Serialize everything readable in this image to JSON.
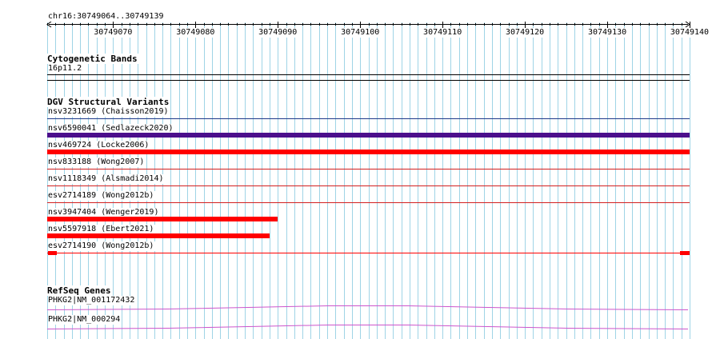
{
  "ruler": {
    "range_label": "chr16:30749064..30749139",
    "start": 30749062,
    "end": 30749140,
    "tick_labels": [
      "30749070",
      "30749080",
      "30749090",
      "30749100",
      "30749110",
      "30749120",
      "30749130",
      "30749140"
    ]
  },
  "tracks": {
    "cytoband": {
      "title": "Cytogenetic Bands",
      "band": "16p11.2"
    },
    "dgv": {
      "title": "DGV Structural Variants",
      "variants": [
        {
          "label": "nsv3231669 (Chaisson2019)",
          "start": 30749062,
          "end": 30749140,
          "color": "#1f3a8a",
          "thick": false
        },
        {
          "label": "nsv6590041 (Sedlazeck2020)",
          "start": 30749062,
          "end": 30749140,
          "color": "#4b0f8c",
          "thick": true
        },
        {
          "label": "nsv469724 (Locke2006)",
          "start": 30749062,
          "end": 30749140,
          "color": "#ff0000",
          "thick": true
        },
        {
          "label": "nsv833188 (Wong2007)",
          "start": 30749062,
          "end": 30749140,
          "color": "#d22020",
          "thick": false
        },
        {
          "label": "nsv1118349 (Alsmadi2014)",
          "start": 30749062,
          "end": 30749140,
          "color": "#d22020",
          "thick": false
        },
        {
          "label": "esv2714189 (Wong2012b)",
          "start": 30749062,
          "end": 30749140,
          "color": "#d22020",
          "thick": false
        },
        {
          "label": "nsv3947404 (Wenger2019)",
          "start": 30749062,
          "end": 30749090,
          "color": "#ff0000",
          "thick": true
        },
        {
          "label": "nsv5597918 (Ebert2021)",
          "start": 30749062,
          "end": 30749089,
          "color": "#ff0000",
          "thick": true
        },
        {
          "label": "esv2714190 (Wong2012b)",
          "start": 30749062,
          "end": 30749140,
          "color": "#ff0000",
          "thick": false,
          "end_blocks": true
        }
      ]
    },
    "refseq": {
      "title": "RefSeq Genes",
      "genes": [
        {
          "label": "PHKG2|NM_001172432",
          "color": "#cc55cc"
        },
        {
          "label": "PHKG2|NM_000294",
          "color": "#cc55cc"
        }
      ]
    }
  },
  "colors": {
    "grid": "#9fd4e6",
    "text": "#000000",
    "axis": "#000000"
  }
}
